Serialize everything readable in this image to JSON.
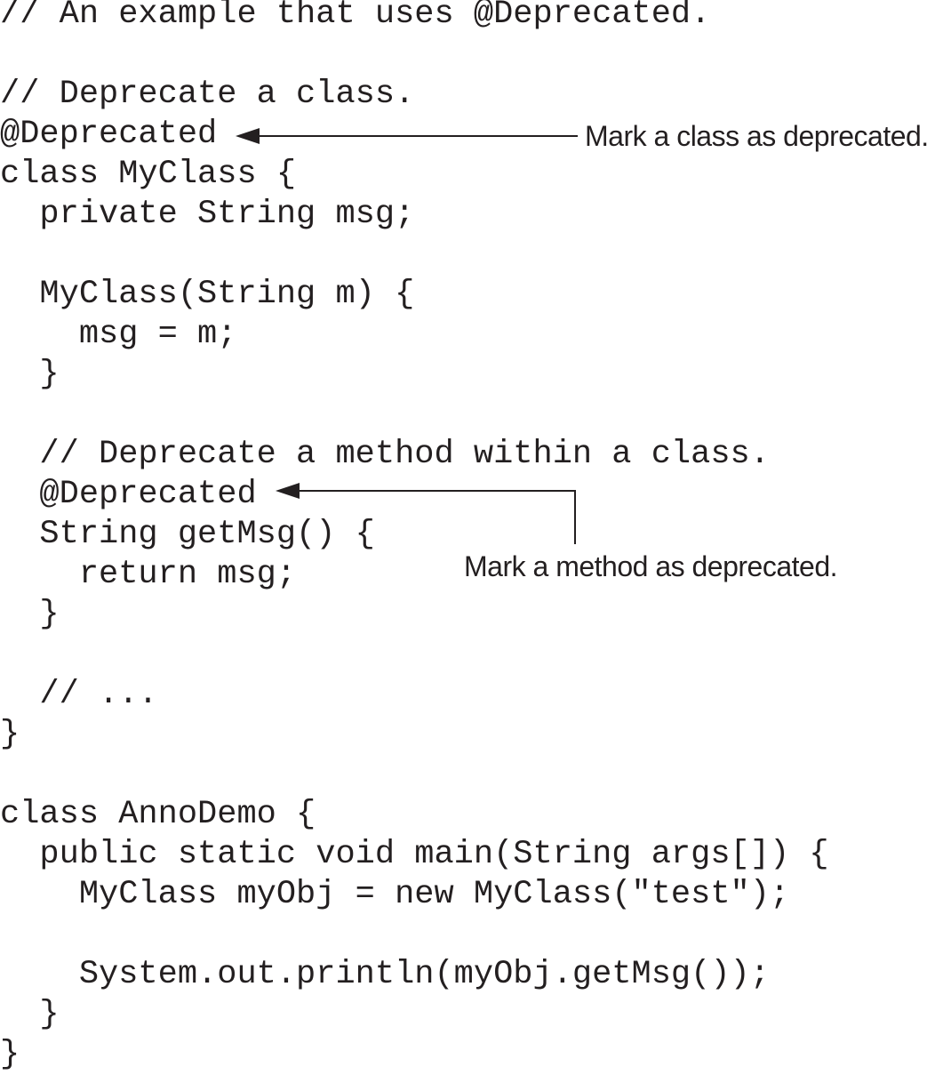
{
  "code_lines": [
    "// An example that uses @Deprecated.",
    "",
    "// Deprecate a class.",
    "@Deprecated",
    "class MyClass {",
    "  private String msg;",
    "",
    "  MyClass(String m) {",
    "    msg = m;",
    "  }",
    "",
    "  // Deprecate a method within a class.",
    "  @Deprecated",
    "  String getMsg() {",
    "    return msg;",
    "  }",
    "",
    "  // ...",
    "}",
    "",
    "class AnnoDemo {",
    "  public static void main(String args[]) {",
    "    MyClass myObj = new MyClass(\"test\");",
    "",
    "    System.out.println(myObj.getMsg());",
    "  }",
    "}"
  ],
  "annotations": {
    "class_note": "Mark a class as deprecated.",
    "method_note": "Mark a method as deprecated."
  },
  "colors": {
    "text": "#231f20",
    "background": "#ffffff"
  }
}
